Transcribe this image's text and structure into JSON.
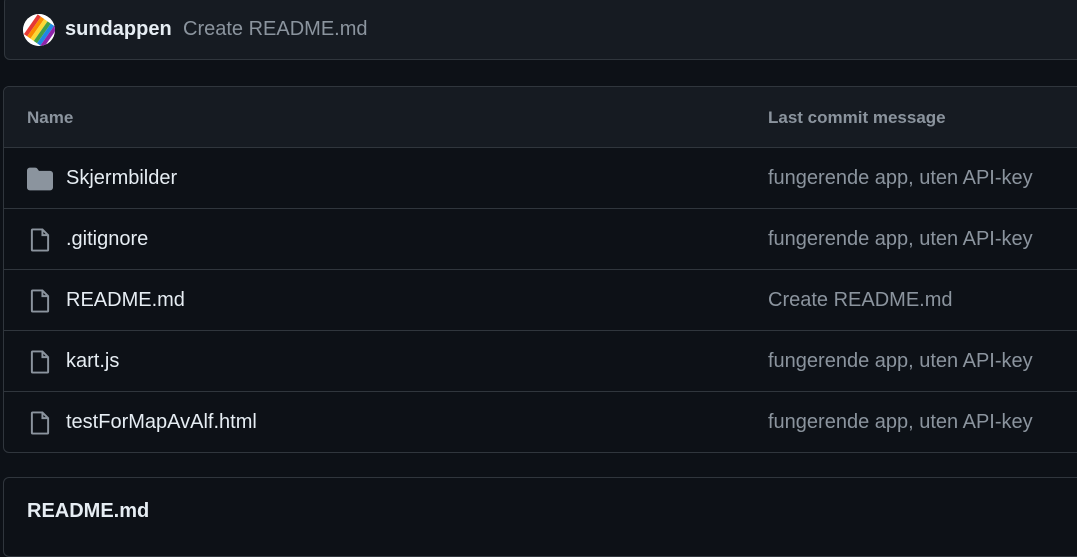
{
  "latest_commit": {
    "author": "sundappen",
    "message": "Create README.md"
  },
  "file_table": {
    "headers": {
      "name": "Name",
      "last_commit_message": "Last commit message"
    },
    "rows": [
      {
        "type": "folder",
        "icon": "folder-icon",
        "name": "Skjermbilder",
        "message": "fungerende app, uten API-key"
      },
      {
        "type": "file",
        "icon": "file-icon",
        "name": ".gitignore",
        "message": "fungerende app, uten API-key"
      },
      {
        "type": "file",
        "icon": "file-icon",
        "name": "README.md",
        "message": "Create README.md"
      },
      {
        "type": "file",
        "icon": "file-icon",
        "name": "kart.js",
        "message": "fungerende app, uten API-key"
      },
      {
        "type": "file",
        "icon": "file-icon",
        "name": "testForMapAvAlf.html",
        "message": "fungerende app, uten API-key"
      }
    ]
  },
  "readme": {
    "title": "README.md"
  },
  "colors": {
    "background": "#0d1117",
    "panel": "#161b22",
    "border": "#30363d",
    "text": "#e6edf3",
    "muted": "#8b949e"
  }
}
